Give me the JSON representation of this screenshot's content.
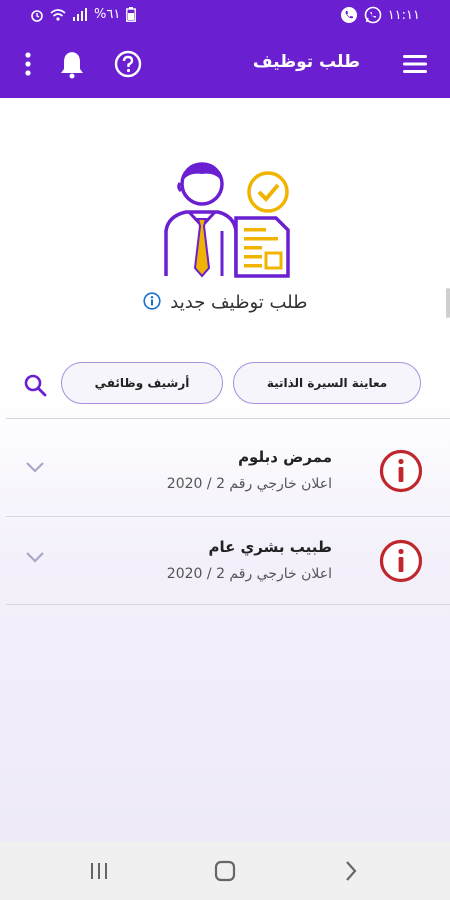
{
  "status_bar": {
    "time": "١١:١١",
    "battery": "%٦١"
  },
  "app_bar": {
    "title": "طلب توظيف"
  },
  "new_application": {
    "label": "طلب توظيف جديد"
  },
  "actions": {
    "resume_preview": "معاينة السيرة الذاتية",
    "archive": "أرشيف وظائفي"
  },
  "applications": [
    {
      "name": "ممرض دبلوم",
      "detail": "اعلان خارجي رقم 2 / 2020"
    },
    {
      "name": "طبيب  بشري عام",
      "detail": "اعلان خارجي رقم 2 / 2020"
    }
  ],
  "colors": {
    "primary": "#6a1fd1",
    "accent": "#f0a800",
    "warning": "#c0272d"
  }
}
